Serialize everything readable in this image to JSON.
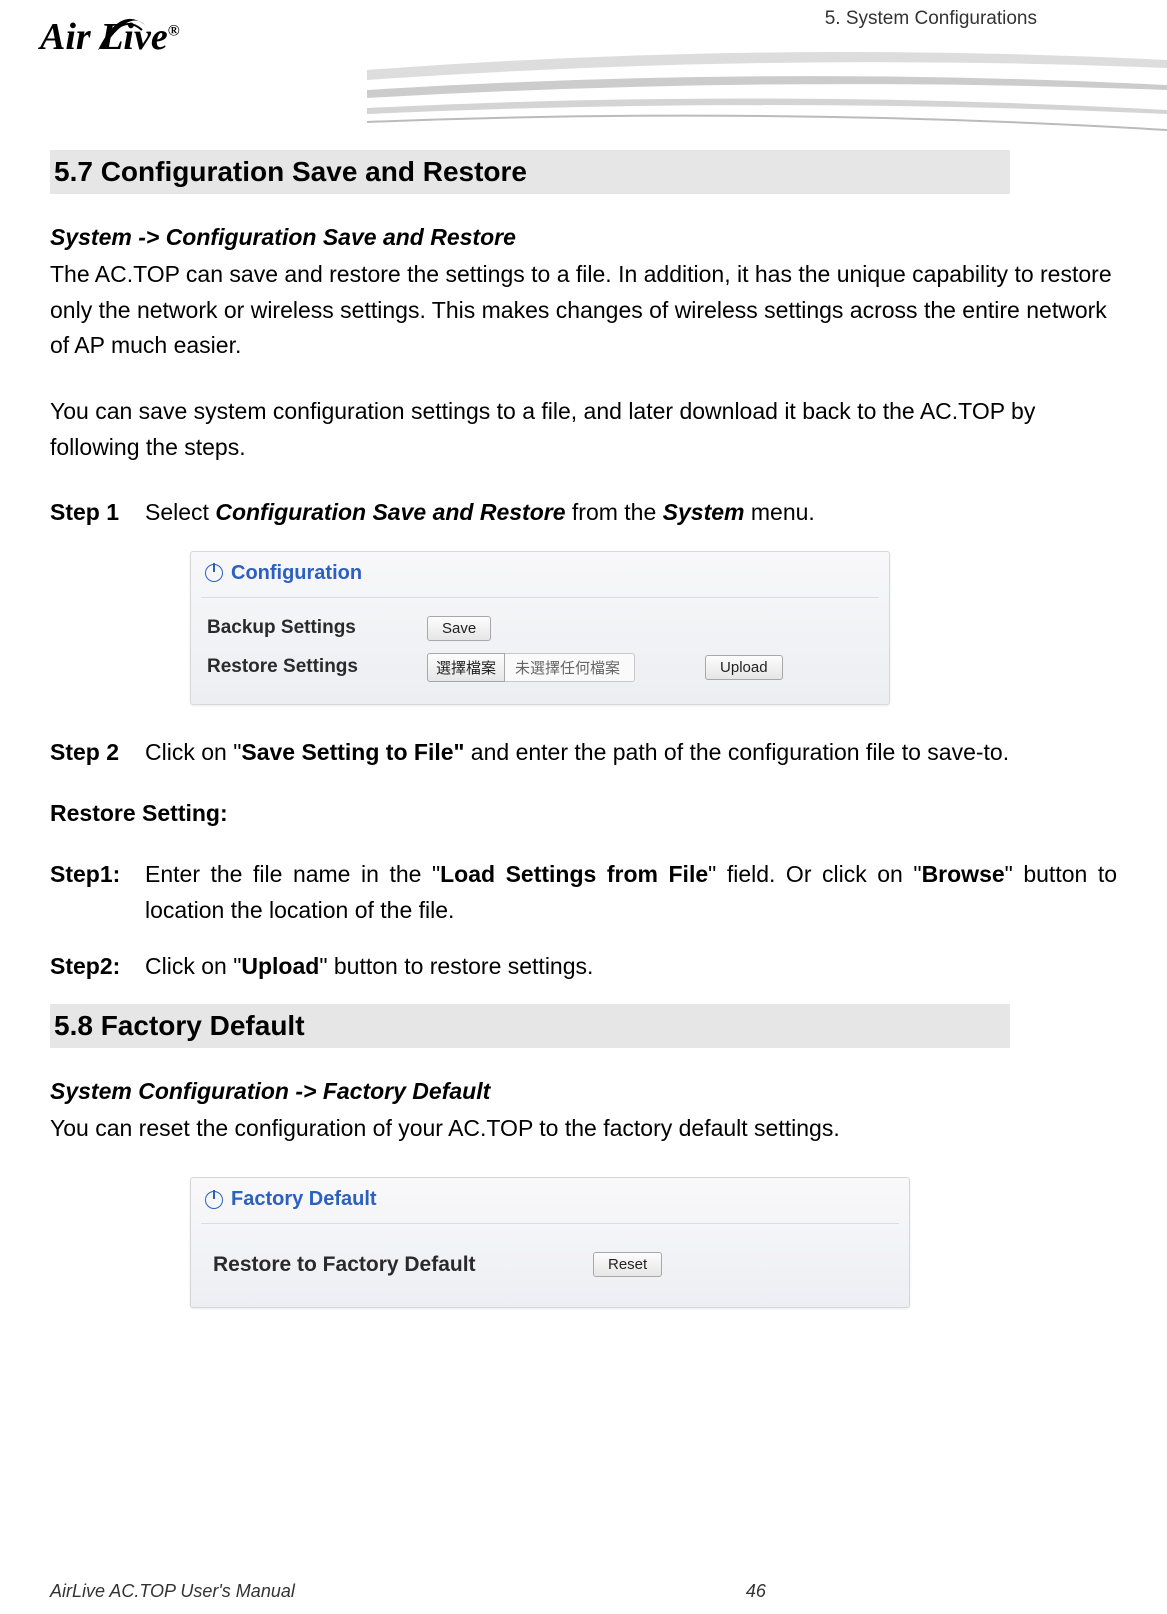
{
  "chapter_header": "5. System Configurations",
  "logo_text": "Air Live",
  "logo_reg": "®",
  "section_5_7": {
    "heading": "5.7 Configuration Save and Restore",
    "breadcrumb": "System -> Configuration Save and Restore",
    "para1": "The AC.TOP can save and restore the settings to a file.   In addition, it has the unique capability to restore only the network or wireless settings.   This makes changes of wireless settings across the entire network of AP much easier.",
    "para2": "You can save system configuration settings to a file, and later download it back to the AC.TOP by following the steps.",
    "step1_label": "Step 1",
    "step1_pre": "Select ",
    "step1_em1": "Configuration Save and Restore",
    "step1_mid": " from the ",
    "step1_em2": "System",
    "step1_post": " menu.",
    "panel": {
      "title": "Configuration",
      "backup_label": "Backup Settings",
      "save_btn": "Save",
      "restore_label": "Restore Settings",
      "browse_btn": "選擇檔案",
      "no_file": "未選擇任何檔案",
      "upload_btn": "Upload"
    },
    "step2_label": "Step 2",
    "step2_pre": "Click on \"",
    "step2_em": "Save Setting to File\"",
    "step2_post": " and enter the path of the configuration file to save-to.",
    "restore_heading": "Restore Setting:",
    "r_step1_label": "Step1",
    "r_step1_colon": ":",
    "r_step1_pre": "Enter the file name in the \"",
    "r_step1_em1": "Load Settings from File",
    "r_step1_mid": "\" field.   Or click on \"",
    "r_step1_em2": "Browse",
    "r_step1_post": "\" button to location the location of the file.",
    "r_step2_label": "Step2",
    "r_step2_colon": ":",
    "r_step2_pre": "Click on \"",
    "r_step2_em": "Upload",
    "r_step2_post": "\" button to restore settings."
  },
  "section_5_8": {
    "heading": "5.8 Factory Default",
    "breadcrumb": "System Configuration -> Factory Default",
    "para": "You can reset the configuration of your AC.TOP to the factory default settings.",
    "panel": {
      "title": "Factory Default",
      "restore_label": "Restore to Factory Default",
      "reset_btn": "Reset"
    }
  },
  "footer": {
    "title": "AirLive AC.TOP User's Manual",
    "page": "46"
  }
}
